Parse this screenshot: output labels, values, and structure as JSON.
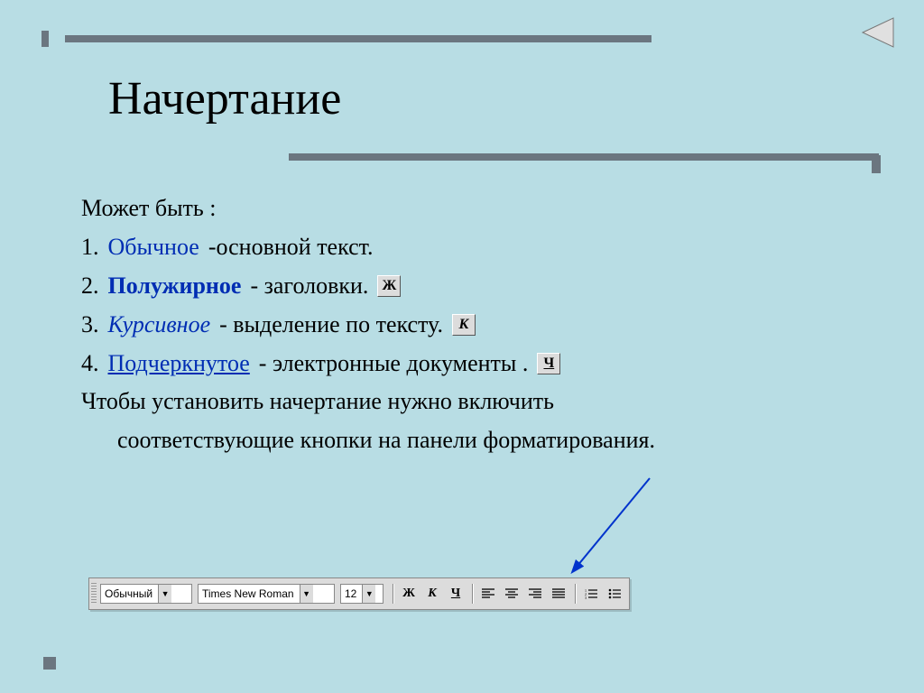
{
  "title": "Начертание",
  "intro": "Может быть :",
  "items": [
    {
      "num": "1.",
      "label": "Обычное",
      "rest": "-основной текст."
    },
    {
      "num": "2.",
      "label": "Полужирное",
      "rest": "- заголовки."
    },
    {
      "num": "3.",
      "label": "Курсивное",
      "rest": "- выделение по тексту."
    },
    {
      "num": "4.",
      "label": "Подчеркнутое",
      "rest": "- электронные документы ."
    }
  ],
  "tail": [
    "Чтобы установить начертание нужно включить",
    "соответствующие кнопки на панели форматирования."
  ],
  "icons": {
    "bold": "Ж",
    "italic": "К",
    "underline": "Ч"
  },
  "toolbar": {
    "style": "Обычный",
    "font": "Times New Roman",
    "size": "12",
    "bold": "Ж",
    "italic": "К",
    "underline": "Ч"
  }
}
